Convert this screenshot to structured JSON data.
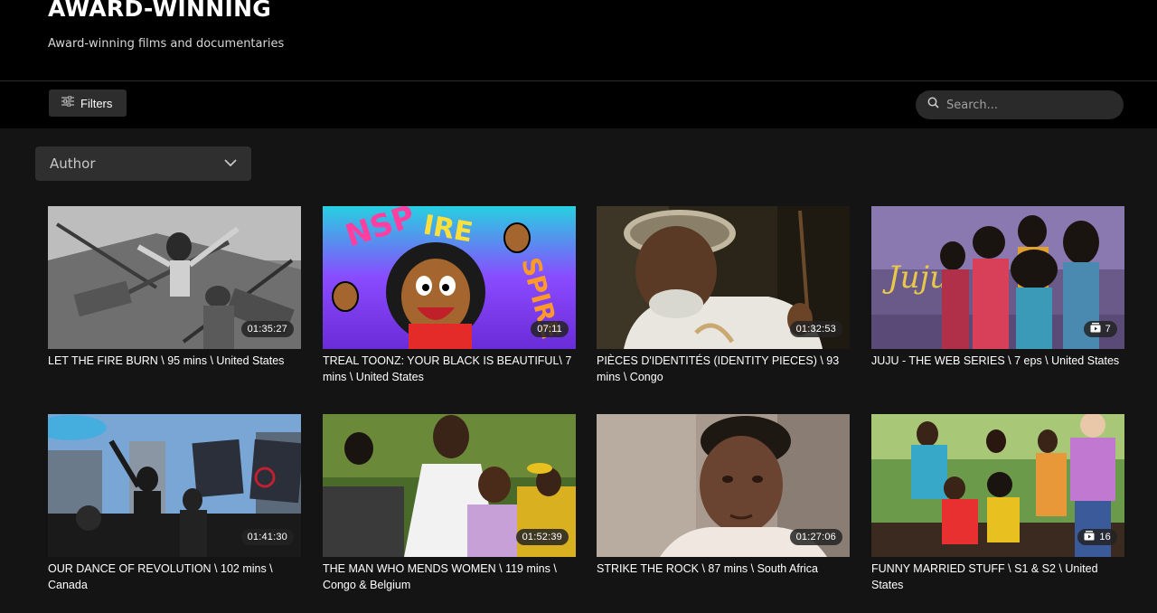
{
  "page": {
    "title": "AWARD-WINNING",
    "subtitle": "Award-winning films and documentaries"
  },
  "toolbar": {
    "filters_label": "Filters",
    "search_placeholder": "Search..."
  },
  "filter": {
    "author_label": "Author"
  },
  "cards": [
    {
      "caption": "LET THE FIRE BURN \\ 95 mins \\ United States",
      "badge": "01:35:27",
      "badge_type": "duration"
    },
    {
      "caption": "TREAL TOONZ: YOUR BLACK IS BEAUTIFUL\\ 7 mins \\ United States",
      "badge": "07:11",
      "badge_type": "duration"
    },
    {
      "caption": "PIÈCES D'IDENTITÉS (IDENTITY PIECES) \\ 93 mins \\ Congo",
      "badge": "01:32:53",
      "badge_type": "duration"
    },
    {
      "caption": "JUJU - THE WEB SERIES \\ 7 eps \\ United States",
      "badge": "7",
      "badge_type": "episodes"
    },
    {
      "caption": "OUR DANCE OF REVOLUTION \\ 102 mins \\ Canada",
      "badge": "01:41:30",
      "badge_type": "duration"
    },
    {
      "caption": "THE MAN WHO MENDS WOMEN \\ 119 mins \\ Congo & Belgium",
      "badge": "01:52:39",
      "badge_type": "duration"
    },
    {
      "caption": "STRIKE THE ROCK \\ 87 mins \\ South Africa",
      "badge": "01:27:06",
      "badge_type": "duration"
    },
    {
      "caption": "FUNNY MARRIED STUFF \\ S1 & S2 \\ United States",
      "badge": "16",
      "badge_type": "episodes"
    }
  ],
  "icons": {
    "filters": "sliders-icon",
    "search": "search-icon",
    "dropdown": "chevron-down-icon",
    "episodes": "episodes-stack-icon"
  },
  "colors": {
    "background": "#141414",
    "header": "#000000",
    "button": "#2d2d2d",
    "search": "#2a2a2a"
  }
}
